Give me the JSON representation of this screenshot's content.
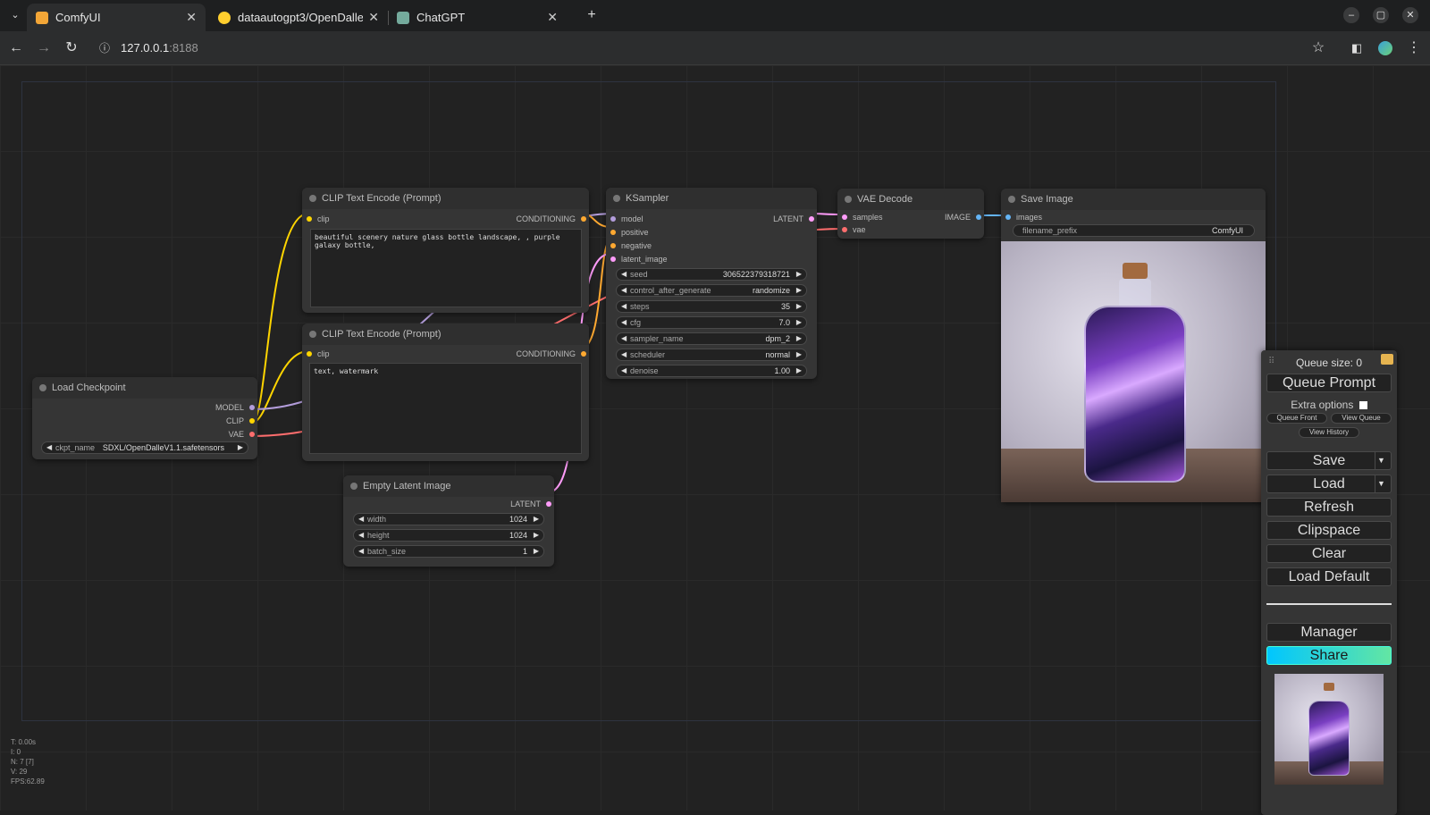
{
  "browser": {
    "tabs": [
      {
        "title": "ComfyUI",
        "active": true
      },
      {
        "title": "dataautogpt3/OpenDalle",
        "active": false
      },
      {
        "title": "ChatGPT",
        "active": false
      }
    ],
    "new_tab": "+",
    "url_host": "127.0.0.1",
    "url_port": ":8188"
  },
  "nodes": {
    "clip1": {
      "title": "CLIP Text Encode (Prompt)",
      "in_clip": "clip",
      "out": "CONDITIONING",
      "text": "beautiful scenery nature glass bottle landscape, , purple galaxy bottle,"
    },
    "clip2": {
      "title": "CLIP Text Encode (Prompt)",
      "in_clip": "clip",
      "out": "CONDITIONING",
      "text": "text, watermark"
    },
    "ksampler": {
      "title": "KSampler",
      "inputs": [
        "model",
        "positive",
        "negative",
        "latent_image"
      ],
      "out": "LATENT",
      "widgets": [
        {
          "label": "seed",
          "value": "306522379318721"
        },
        {
          "label": "control_after_generate",
          "value": "randomize"
        },
        {
          "label": "steps",
          "value": "35"
        },
        {
          "label": "cfg",
          "value": "7.0"
        },
        {
          "label": "sampler_name",
          "value": "dpm_2"
        },
        {
          "label": "scheduler",
          "value": "normal"
        },
        {
          "label": "denoise",
          "value": "1.00"
        }
      ]
    },
    "vae": {
      "title": "VAE Decode",
      "in_samples": "samples",
      "in_vae": "vae",
      "out": "IMAGE"
    },
    "save": {
      "title": "Save Image",
      "in_images": "images",
      "prefix_label": "filename_prefix",
      "prefix_value": "ComfyUI"
    },
    "checkpoint": {
      "title": "Load Checkpoint",
      "outs": [
        "MODEL",
        "CLIP",
        "VAE"
      ],
      "ckpt_label": "ckpt_name",
      "ckpt_value": "SDXL/OpenDalleV1.1.safetensors"
    },
    "latent": {
      "title": "Empty Latent Image",
      "out": "LATENT",
      "widgets": [
        {
          "label": "width",
          "value": "1024"
        },
        {
          "label": "height",
          "value": "1024"
        },
        {
          "label": "batch_size",
          "value": "1"
        }
      ]
    }
  },
  "menu": {
    "queue_size": "Queue size: 0",
    "queue_prompt": "Queue Prompt",
    "extra_options": "Extra options",
    "queue_front": "Queue Front",
    "view_queue": "View Queue",
    "view_history": "View History",
    "save": "Save",
    "load": "Load",
    "refresh": "Refresh",
    "clipspace": "Clipspace",
    "clear": "Clear",
    "load_default": "Load Default",
    "manager": "Manager",
    "share": "Share"
  },
  "stats": [
    "T: 0.00s",
    "I: 0",
    "N: 7 [7]",
    "V: 29",
    "FPS:62.89"
  ],
  "colors": {
    "clip_link": "#ffd500",
    "model_link": "#b39ddb",
    "vae_link": "#ff6e6e",
    "latent_link": "#ff9cf9",
    "conditioning_link": "#ffa931",
    "image_link": "#64b5f6",
    "share_gradient": [
      "#00c6ff",
      "#63e6a3"
    ]
  }
}
